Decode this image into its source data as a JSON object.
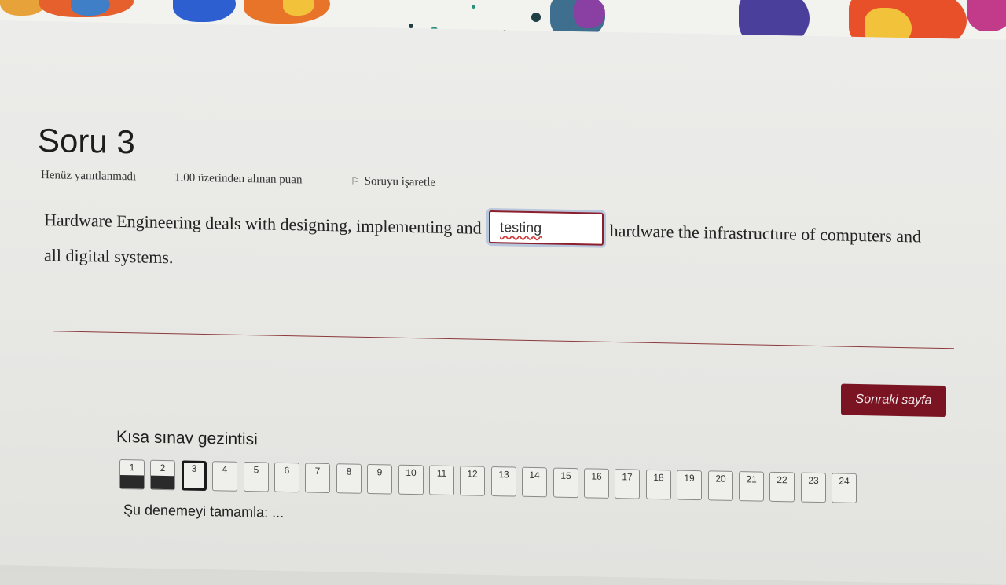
{
  "question": {
    "title": "Soru 3",
    "status": "Henüz yanıtlanmadı",
    "points": "1.00 üzerinden alınan puan",
    "flag_label": "Soruyu işaretle",
    "text_before": "Hardware Engineering deals with designing, implementing and",
    "answer_value": "testing",
    "text_after": "hardware the infrastructure of computers and all digital systems."
  },
  "next_button": {
    "label": "Sonraki sayfa"
  },
  "navigation": {
    "title": "Kısa sınav gezintisi",
    "buttons": [
      "1",
      "2",
      "3",
      "4",
      "5",
      "6",
      "7",
      "8",
      "9",
      "10",
      "11",
      "12",
      "13",
      "14",
      "15",
      "16",
      "17",
      "18",
      "19",
      "20",
      "21",
      "22",
      "23",
      "24"
    ],
    "answered": [
      1,
      2
    ],
    "current": 3,
    "finish_link": "Şu denemeyi tamamla: ..."
  },
  "colors": {
    "accent": "#7a1422",
    "answer_border": "#8c1f2c"
  },
  "icons": {
    "flag": "flag-icon",
    "cursor": "mouse-pointer-icon"
  }
}
